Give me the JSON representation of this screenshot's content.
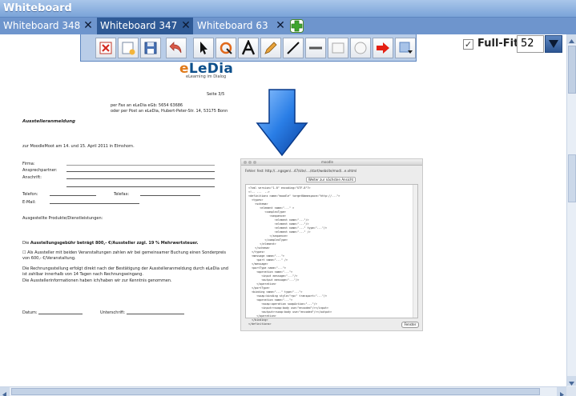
{
  "app": {
    "title": "Whiteboard"
  },
  "tabs": [
    {
      "label": "Whiteboard 348",
      "close": "✕"
    },
    {
      "label": "Whiteboard 347",
      "close": "✕"
    },
    {
      "label": "Whiteboard 63",
      "close": "✕"
    }
  ],
  "toolbar": {
    "tools": [
      "delete-icon",
      "new-page-icon",
      "save-icon",
      "undo-icon",
      "pointer-icon",
      "rotate-icon",
      "text-icon",
      "pencil-icon",
      "line-icon",
      "thick-line-icon",
      "rectangle-icon",
      "ellipse-icon",
      "arrow-icon",
      "paste-icon"
    ]
  },
  "view": {
    "fullfit_label": "Full-Fit",
    "fullfit_checked": "✓",
    "zoom": "52"
  },
  "logo": {
    "brand_e": "e",
    "brand_rest": "LeDia",
    "tagline": "eLearning im Dialog"
  },
  "document": {
    "page": "Seite 3/5",
    "header_line1": "per Fax an eLeDia eGb: 5654 63686",
    "header_line2": "oder per Post an eLeDia, Hubert-Peter-Str. 14, 53175 Bonn",
    "heading": "Ausstelleranmeldung",
    "intro": "zur MoodleMoot am 14. und 15. April 2011 in Elmshorn.",
    "field_company": "Firma:",
    "field_contact": "Ansprechpartner:",
    "field_address": "Anschrift:",
    "field_phone": "Telefon:",
    "field_fax": "Telefax:",
    "field_email": "E-Mail:",
    "products": "Ausgestellte Produkte/Dienstleistungen:",
    "fee_prefix": "Die ",
    "fee_bold": "Ausstellungsgebühr beträgt  800,- €/Aussteller zzgl. 19 % Mehrwertsteuer.",
    "option_line1": "Als Aussteller mit beiden Veranstaltungen zahlen wir bei gemeinsamer Buchung einen Sonderpreis",
    "option_line2": "von 600,- €/Veranstaltung.",
    "billing_line1": "Die Rechnungsstellung erfolgt direkt nach der Bestätigung der Ausstelleranmeldung durch eLeDia und",
    "billing_line2": "ist zahlbar innerhalb von 14 Tagen nach Rechnungseingang.",
    "info_line": "Die Ausstellerinformationen haben ich/haben wir zur Kenntnis genommen.",
    "date_label": "Datum:",
    "signature_label": "Unterschrift:"
  },
  "screenshot": {
    "title": "moodle",
    "url": "Fehler:  fest: http://...ngsgen/...47/site/..../start/website/mod/...e.xhtml",
    "button": "Weiter zur nächsten Ansicht",
    "close_button": "Fenster",
    "code": "<?xml version=\"1.0\" encoding=\"UTF-8\"?>\n<!-- ...  -->\n<definitions name=\"moodle\" targetNamespace=\"http://...\">\n  <types>\n    <schema>\n       <element name=\"...\" >\n          <complexType>\n             <sequence>\n                <element name=\"...\"/>\n                <element name=\"...\"/>\n                <element name=\"...\" type=\"...\"/>\n                <element name=\"...\" />\n             </sequence>\n          </complexType>\n       </element>\n    </schema>\n  </types>\n  <message name=\"...\">\n     <part name=\"...\" />\n  </message>\n  <portType name=\"...\">\n     <operation name=\"...\">\n        <input message=\"...\"/>\n        <output message=\"...\"/>\n     </operation>\n  </portType>\n  <binding name=\"...\" type=\"...\">\n     <soap:binding style=\"rpc\" transport=\"...\"/>\n     <operation name=\"...\">\n        <soap:operation soapAction=\"...\"/>\n        <input><soap:body use=\"encoded\"/></input>\n        <output><soap:body use=\"encoded\"/></output>\n     </operation>\n  </binding>\n</definitions>"
  },
  "colors": {
    "titlebar": "#7aa3d8",
    "tabs": "#6e95cd",
    "active_tab": "#2f5a96",
    "accent": "#0d4f8b"
  }
}
